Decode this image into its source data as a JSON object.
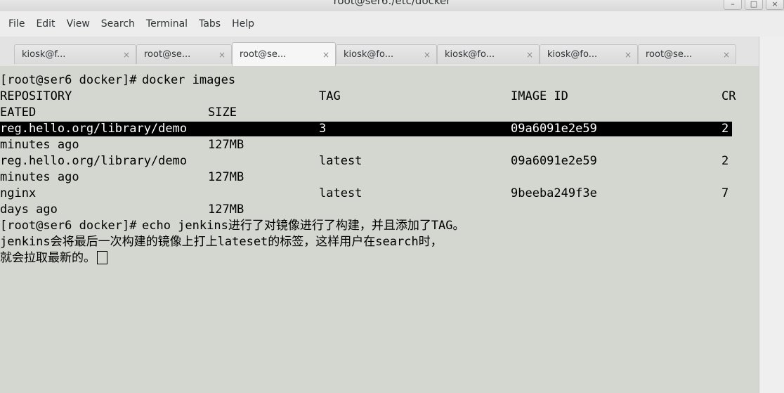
{
  "window": {
    "title": "root@ser6:/etc/docker"
  },
  "menu": [
    "File",
    "Edit",
    "View",
    "Search",
    "Terminal",
    "Tabs",
    "Help"
  ],
  "tabs": [
    {
      "label": "kiosk@f...",
      "active": false
    },
    {
      "label": "root@se...",
      "active": false
    },
    {
      "label": "root@se...",
      "active": true
    },
    {
      "label": "kiosk@fo...",
      "active": false
    },
    {
      "label": "kiosk@fo...",
      "active": false
    },
    {
      "label": "kiosk@fo...",
      "active": false
    },
    {
      "label": "root@se...",
      "active": false
    }
  ],
  "tab_close_glyph": "×",
  "terminal": {
    "prompt": "[root@ser6 docker]# ",
    "command1": "docker images",
    "headers": {
      "repository": "REPOSITORY",
      "tag": "TAG",
      "image_id": "IMAGE ID",
      "created_part1": "CR",
      "created_part2": "EATED",
      "size": "SIZE"
    },
    "rows": [
      {
        "repository": "reg.hello.org/library/demo",
        "tag": "3",
        "image_id": "09a6091e2e59",
        "created_part1": "2",
        "created_part2": "minutes ago",
        "size": "127MB",
        "highlighted": true
      },
      {
        "repository": "reg.hello.org/library/demo",
        "tag": "latest",
        "image_id": "09a6091e2e59",
        "created_part1": "2",
        "created_part2": "minutes ago",
        "size": "127MB",
        "highlighted": false
      },
      {
        "repository": "nginx",
        "tag": "latest",
        "image_id": "9beeba249f3e",
        "created_part1": "7",
        "created_part2": "days ago",
        "size": "127MB",
        "highlighted": false
      }
    ],
    "command2": "echo jenkins进行了对镜像进行了构建，并且添加了TAG。",
    "wrap1": "jenkins会将最后一次构建的镜像上打上lateset的标签，这样用户在search时，",
    "wrap2": "就会拉取最新的。"
  },
  "colors": {
    "terminal_bg": "#d3d7cf",
    "highlight_bg": "#000000",
    "highlight_fg": "#ffffff"
  }
}
